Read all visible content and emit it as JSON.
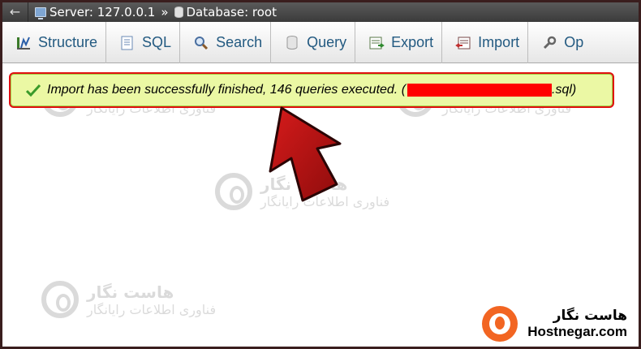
{
  "breadcrumb": {
    "back_glyph": "←",
    "server_label": "Server: 127.0.0.1",
    "separator": "»",
    "database_label": "Database: root"
  },
  "tabs": [
    {
      "label": "Structure",
      "icon": "structure-icon"
    },
    {
      "label": "SQL",
      "icon": "sql-icon"
    },
    {
      "label": "Search",
      "icon": "search-icon"
    },
    {
      "label": "Query",
      "icon": "query-icon"
    },
    {
      "label": "Export",
      "icon": "export-icon"
    },
    {
      "label": "Import",
      "icon": "import-icon"
    },
    {
      "label": "Op",
      "icon": "wrench-icon"
    }
  ],
  "notice": {
    "message_prefix": "Import has been successfully finished, 146 queries executed. (",
    "message_suffix": ".sql)",
    "status_color": "#ebf8a4",
    "highlight_color": "#e01010"
  },
  "watermark": {
    "line1": "هاست نگار",
    "line2": "فناوری اطلاعات رایانگار"
  },
  "brand": {
    "name_fa": "هاست نگار",
    "name_en": "Hostnegar.com",
    "accent": "#f26522"
  }
}
